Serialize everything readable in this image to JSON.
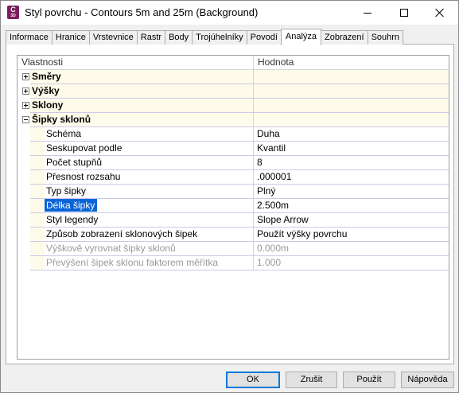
{
  "window": {
    "title": "Styl povrchu - Contours 5m and 25m (Background)",
    "app_icon": {
      "letter": "C",
      "sub": "3D"
    }
  },
  "tabs": [
    {
      "label": "Informace",
      "active": false
    },
    {
      "label": "Hranice",
      "active": false
    },
    {
      "label": "Vrstevnice",
      "active": false
    },
    {
      "label": "Rastr",
      "active": false
    },
    {
      "label": "Body",
      "active": false
    },
    {
      "label": "Trojúhelníky",
      "active": false
    },
    {
      "label": "Povodí",
      "active": false
    },
    {
      "label": "Analýza",
      "active": true
    },
    {
      "label": "Zobrazení",
      "active": false
    },
    {
      "label": "Souhrn",
      "active": false
    }
  ],
  "grid": {
    "header_property": "Vlastnosti",
    "header_value": "Hodnota",
    "categories": [
      {
        "label": "Směry",
        "expanded": false
      },
      {
        "label": "Výšky",
        "expanded": false
      },
      {
        "label": "Sklony",
        "expanded": false
      },
      {
        "label": "Šipky sklonů",
        "expanded": true
      }
    ],
    "properties": [
      {
        "label": "Schéma",
        "value": "Duha",
        "disabled": false,
        "selected": false
      },
      {
        "label": "Seskupovat podle",
        "value": "Kvantil",
        "disabled": false,
        "selected": false
      },
      {
        "label": "Počet stupňů",
        "value": "8",
        "disabled": false,
        "selected": false
      },
      {
        "label": "Přesnost rozsahu",
        "value": ".000001",
        "disabled": false,
        "selected": false
      },
      {
        "label": "Typ šipky",
        "value": "Plný",
        "disabled": false,
        "selected": false
      },
      {
        "label": "Délka šipky",
        "value": "2.500m",
        "disabled": false,
        "selected": true
      },
      {
        "label": "Styl legendy",
        "value": "Slope Arrow",
        "disabled": false,
        "selected": false
      },
      {
        "label": "Způsob zobrazení sklonových šipek",
        "value": "Použít výšky povrchu",
        "disabled": false,
        "selected": false
      },
      {
        "label": "Výškově vyrovnat šipky sklonů",
        "value": "0.000m",
        "disabled": true,
        "selected": false
      },
      {
        "label": "Převýšení šipek sklonu faktorem měřítka",
        "value": "1.000",
        "disabled": true,
        "selected": false
      }
    ]
  },
  "buttons": {
    "ok": "OK",
    "cancel": "Zrušit",
    "apply": "Použít",
    "help": "Nápověda"
  },
  "colors": {
    "category_row_bg": "#fffbea",
    "selection": "#0a64d6",
    "app_icon": "#7d1d5f"
  }
}
